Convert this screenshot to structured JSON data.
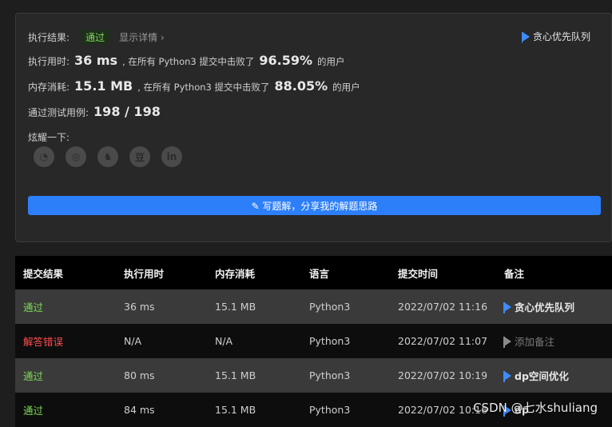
{
  "result": {
    "label": "执行结果:",
    "status": "通过",
    "details": "显示详情 ›",
    "tag": "贪心优先队列",
    "time_label": "执行用时:",
    "time_value": "36 ms",
    "time_mid": ", 在所有 Python3 提交中击败了",
    "time_pct": "96.59%",
    "time_suffix": "的用户",
    "mem_label": "内存消耗:",
    "mem_value": "15.1 MB",
    "mem_mid": ", 在所有 Python3 提交中击败了",
    "mem_pct": "88.05%",
    "mem_suffix": "的用户",
    "cases_label": "通过测试用例:",
    "cases_value": "198 / 198",
    "share_label": "炫耀一下:",
    "share_icons": [
      "wechat-icon",
      "weibo-icon",
      "qq-icon",
      "douban-icon",
      "linkedin-icon"
    ],
    "share_glyphs": [
      "◔",
      "◎",
      "♞",
      "豆",
      "in"
    ],
    "button_label": "✎ 写题解，分享我的解题思路"
  },
  "table": {
    "headers": [
      "提交结果",
      "执行用时",
      "内存消耗",
      "语言",
      "提交时间",
      "备注"
    ],
    "rows": [
      {
        "status": "通过",
        "time": "36 ms",
        "mem": "15.1 MB",
        "lang": "Python3",
        "date": "2022/07/02 11:16",
        "note": "贪心优先队列"
      },
      {
        "status": "解答错误",
        "time": "N/A",
        "mem": "N/A",
        "lang": "Python3",
        "date": "2022/07/02 11:07",
        "note": "添加备注"
      },
      {
        "status": "通过",
        "time": "80 ms",
        "mem": "15.1 MB",
        "lang": "Python3",
        "date": "2022/07/02 10:19",
        "note": "dp空间优化"
      },
      {
        "status": "通过",
        "time": "84 ms",
        "mem": "15.1 MB",
        "lang": "Python3",
        "date": "2022/07/02 10:16",
        "note": "dp"
      }
    ]
  },
  "watermark": "CSDN @七水shuliang",
  "colors": {
    "accent": "#2d7ff9",
    "pass": "#7ed957",
    "error": "#ff4d4f"
  }
}
